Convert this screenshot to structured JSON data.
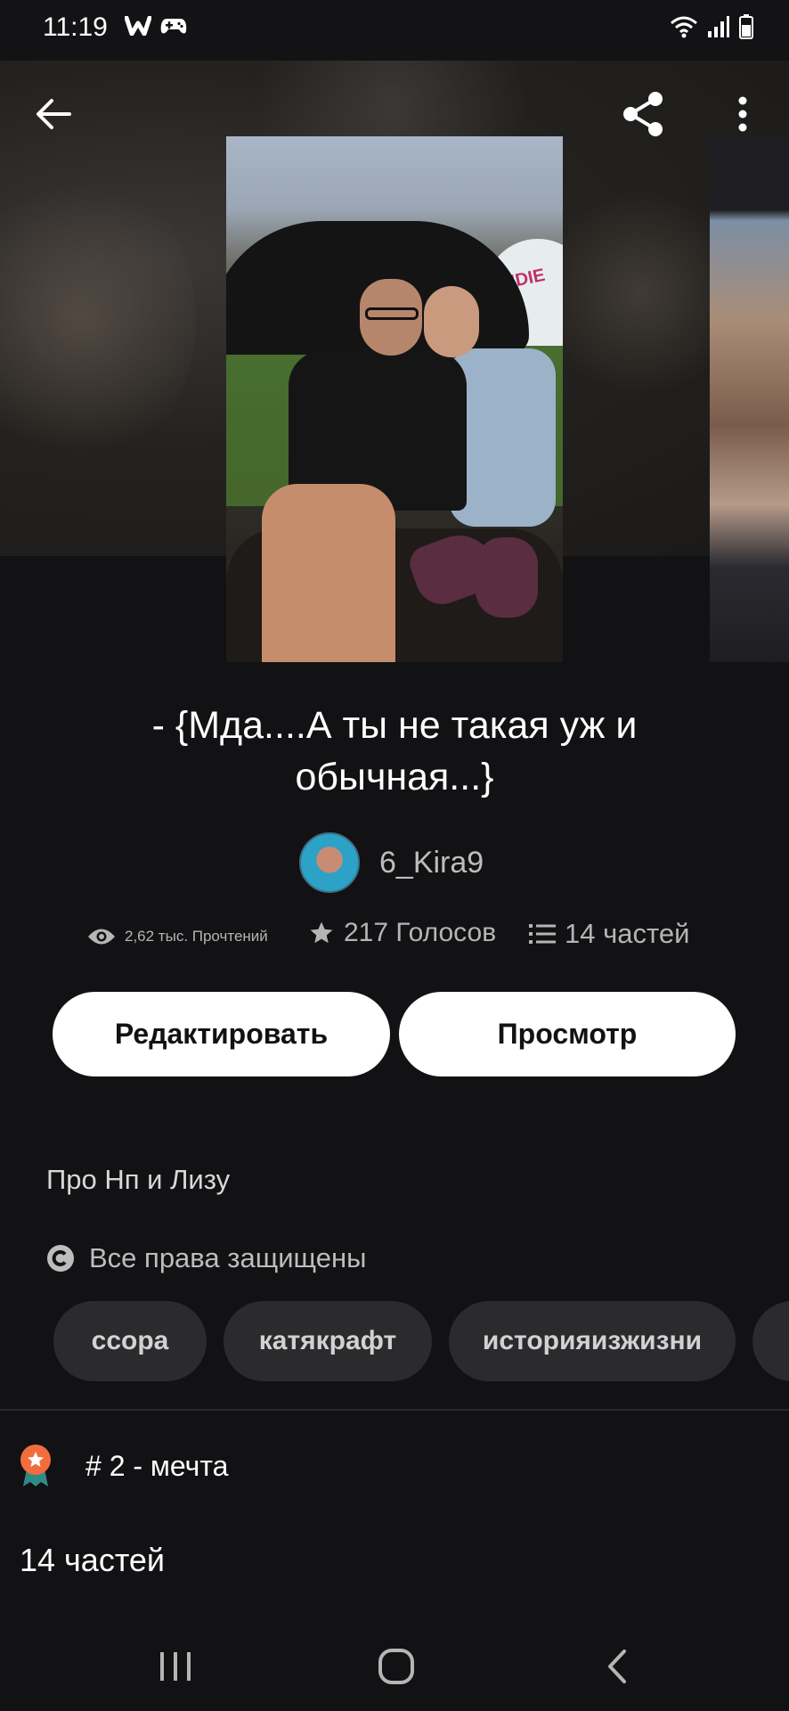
{
  "status_bar": {
    "time": "11:19",
    "notification_icons": [
      "wattpad-w-icon",
      "gamepad-icon"
    ],
    "system_icons": [
      "wifi-icon",
      "signal-icon",
      "battery-icon"
    ]
  },
  "topbar": {
    "back_icon": "arrow-left-icon",
    "share_icon": "share-icon",
    "more_icon": "more-vertical-icon"
  },
  "story": {
    "title": "- {Мда....А ты не такая уж и обычная...}",
    "author": "6_Kira9",
    "stats": {
      "reads": "2,62 тыс. Прочтений",
      "votes": "217 Голосов",
      "parts": "14 частей"
    },
    "buttons": {
      "edit": "Редактировать",
      "view": "Просмотр"
    },
    "description": "Про Нп и Лизу",
    "copyright": "Все права защищены",
    "tags": [
      "ссора",
      "катякрафт",
      "историяизжизни",
      ""
    ],
    "rank": "# 2 - мечта",
    "parts_count": "14 частей"
  },
  "colors": {
    "background": "#121113",
    "button_bg": "#ffffff",
    "tag_bg": "#2b2a2d",
    "rank_badge": "#f26d3d",
    "rank_ribbon": "#2e8b87"
  }
}
